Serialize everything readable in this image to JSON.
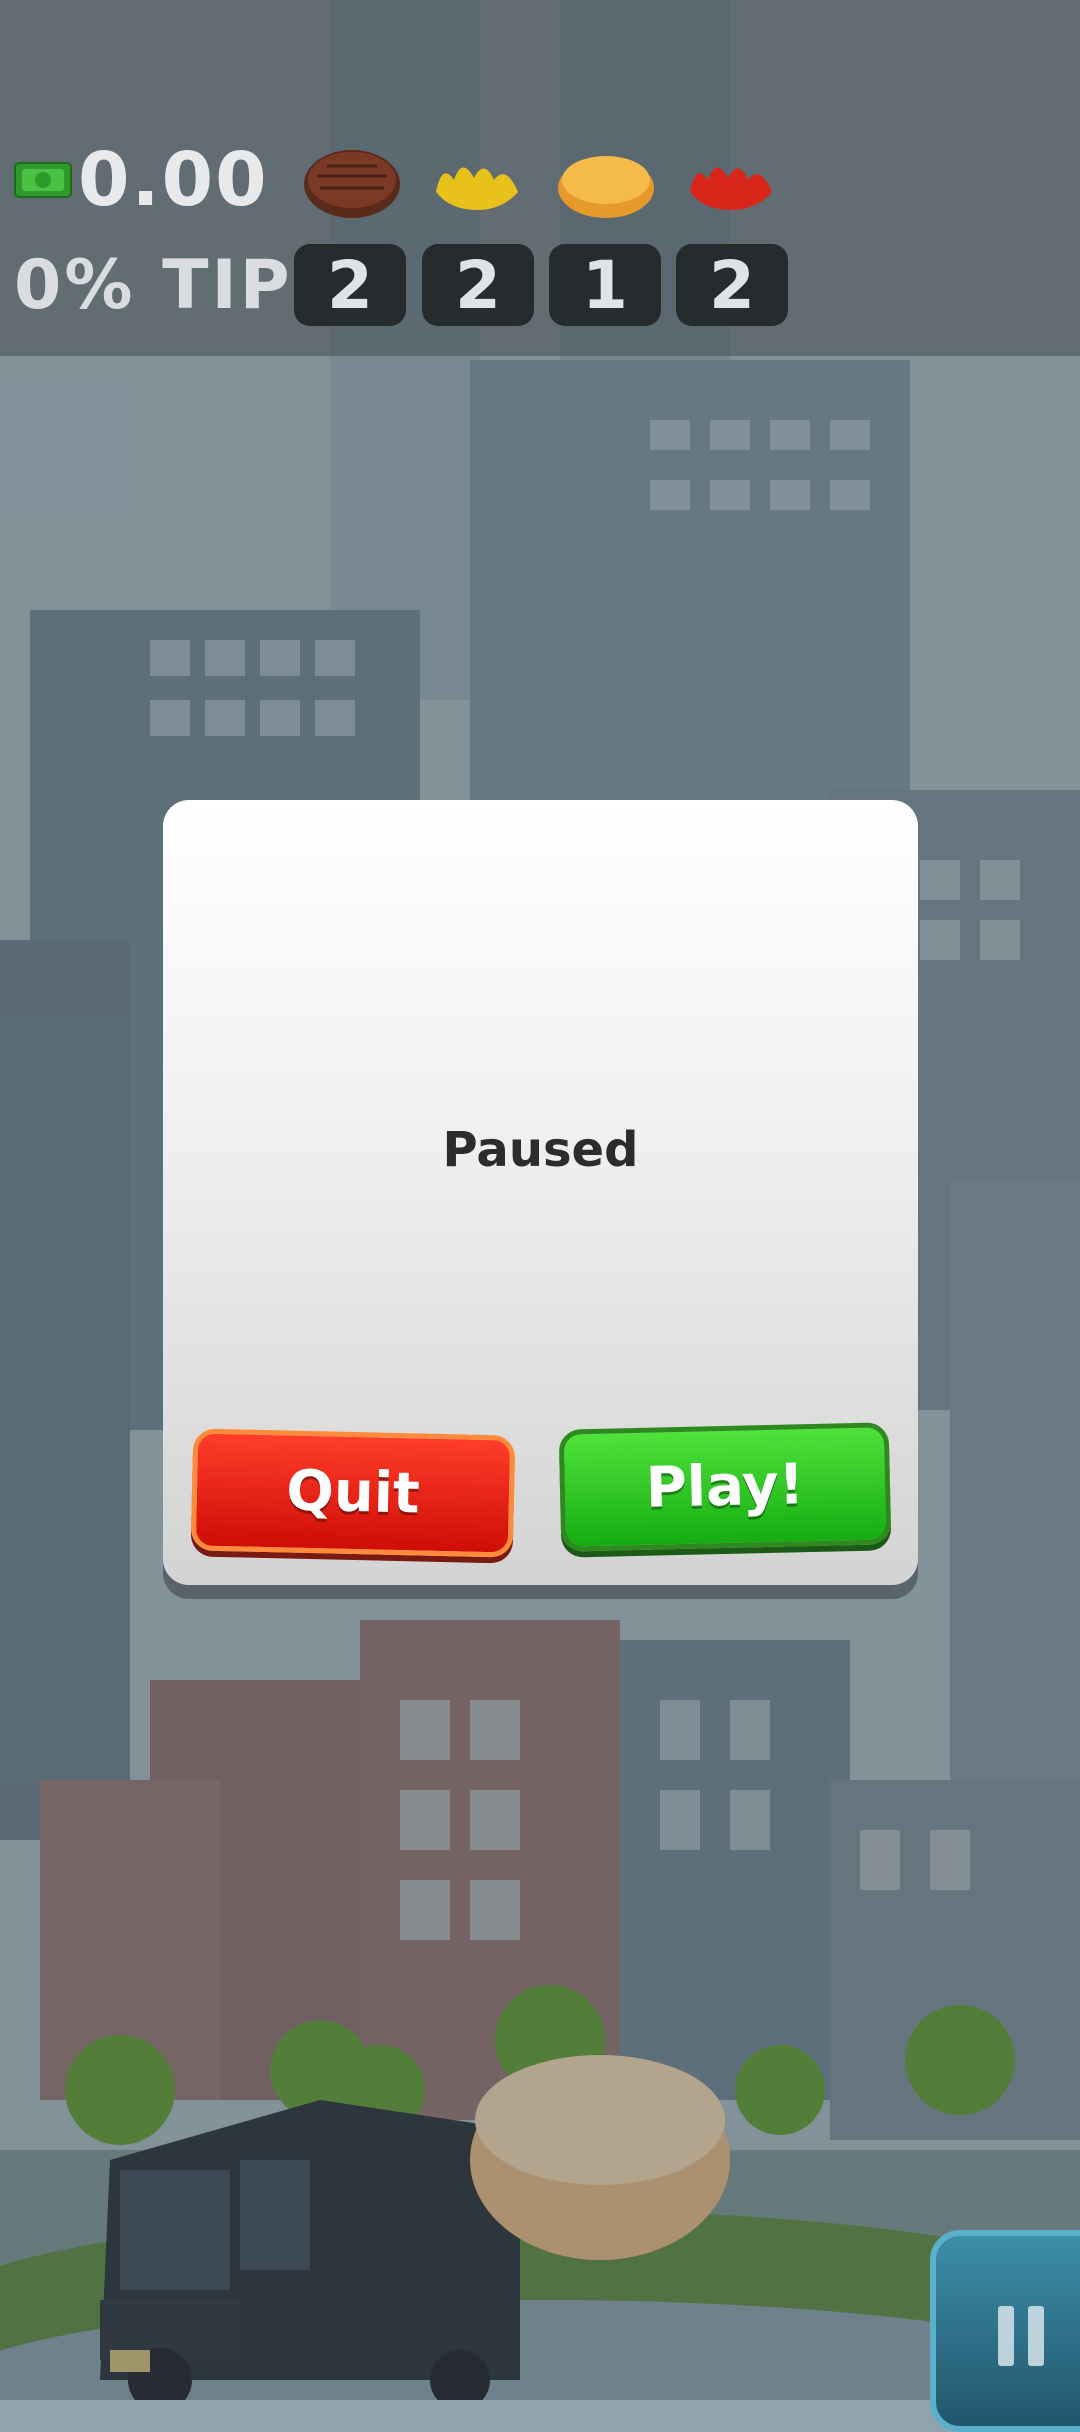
{
  "hud": {
    "money": "0.00",
    "tip": "0% TIP",
    "ingredients": [
      {
        "name": "patty",
        "count": "2"
      },
      {
        "name": "mustard",
        "count": "2"
      },
      {
        "name": "cheese",
        "count": "1"
      },
      {
        "name": "ketchup",
        "count": "2"
      }
    ]
  },
  "dialog": {
    "title": "Paused",
    "quit_label": "Quit",
    "play_label": "Play!"
  },
  "icons": [
    "money-icon",
    "patty-icon",
    "mustard-icon",
    "cheese-icon",
    "ketchup-icon",
    "pause-icon"
  ],
  "colors": {
    "quit": "#e01a10",
    "play": "#2ac11e",
    "hud_text": "#e7e9ea"
  }
}
